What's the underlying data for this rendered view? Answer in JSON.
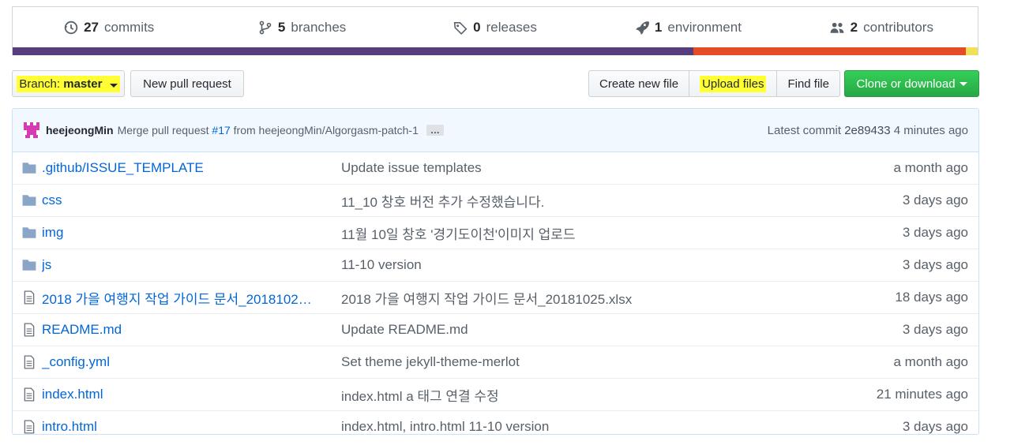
{
  "summary": {
    "commits": {
      "count": "27",
      "label": "commits"
    },
    "branches": {
      "count": "5",
      "label": "branches"
    },
    "releases": {
      "count": "0",
      "label": "releases"
    },
    "environment": {
      "count": "1",
      "label": "environment"
    },
    "contributors": {
      "count": "2",
      "label": "contributors"
    },
    "languages": [
      {
        "color": "#563d7c",
        "percent": 70.5
      },
      {
        "color": "#e34c26",
        "percent": 28.3
      },
      {
        "color": "#f1e05a",
        "percent": 1.2
      }
    ]
  },
  "toolbar": {
    "branch_label": "Branch:",
    "branch_value": "master",
    "new_pull_request": "New pull request",
    "create_new_file": "Create new file",
    "upload_files": "Upload files",
    "find_file": "Find file",
    "clone_or_download": "Clone or download"
  },
  "commit": {
    "author": "heejeongMin",
    "message_prefix": "Merge pull request",
    "pr_link": "#17",
    "message_suffix": "from heejeongMin/Algorgasm-patch-1",
    "ellipsis": "…",
    "latest_label": "Latest commit",
    "sha": "2e89433",
    "time": "4 minutes ago"
  },
  "files": [
    {
      "type": "dir",
      "name": ".github/ISSUE_TEMPLATE",
      "message": "Update issue templates",
      "age": "a month ago"
    },
    {
      "type": "dir",
      "name": "css",
      "message": "11_10 창호 버전 추가 수정했습니다.",
      "age": "3 days ago"
    },
    {
      "type": "dir",
      "name": "img",
      "message": "11월 10일 창호 '경기도이천'이미지 업로드",
      "age": "3 days ago"
    },
    {
      "type": "dir",
      "name": "js",
      "message": "11-10 version",
      "age": "3 days ago"
    },
    {
      "type": "file",
      "name": "2018 가을 여행지 작업 가이드 문서_2018102…",
      "message": "2018 가을 여행지 작업 가이드 문서_20181025.xlsx",
      "age": "18 days ago"
    },
    {
      "type": "file",
      "name": "README.md",
      "message": "Update README.md",
      "age": "3 days ago"
    },
    {
      "type": "file",
      "name": "_config.yml",
      "message": "Set theme jekyll-theme-merlot",
      "age": "a month ago"
    },
    {
      "type": "file",
      "name": "index.html",
      "message": "index.html a 태그 연결 수정",
      "age": "21 minutes ago"
    },
    {
      "type": "file",
      "name": "intro.html",
      "message": "index.html, intro.html 11-10 version",
      "age": "3 days ago"
    }
  ]
}
